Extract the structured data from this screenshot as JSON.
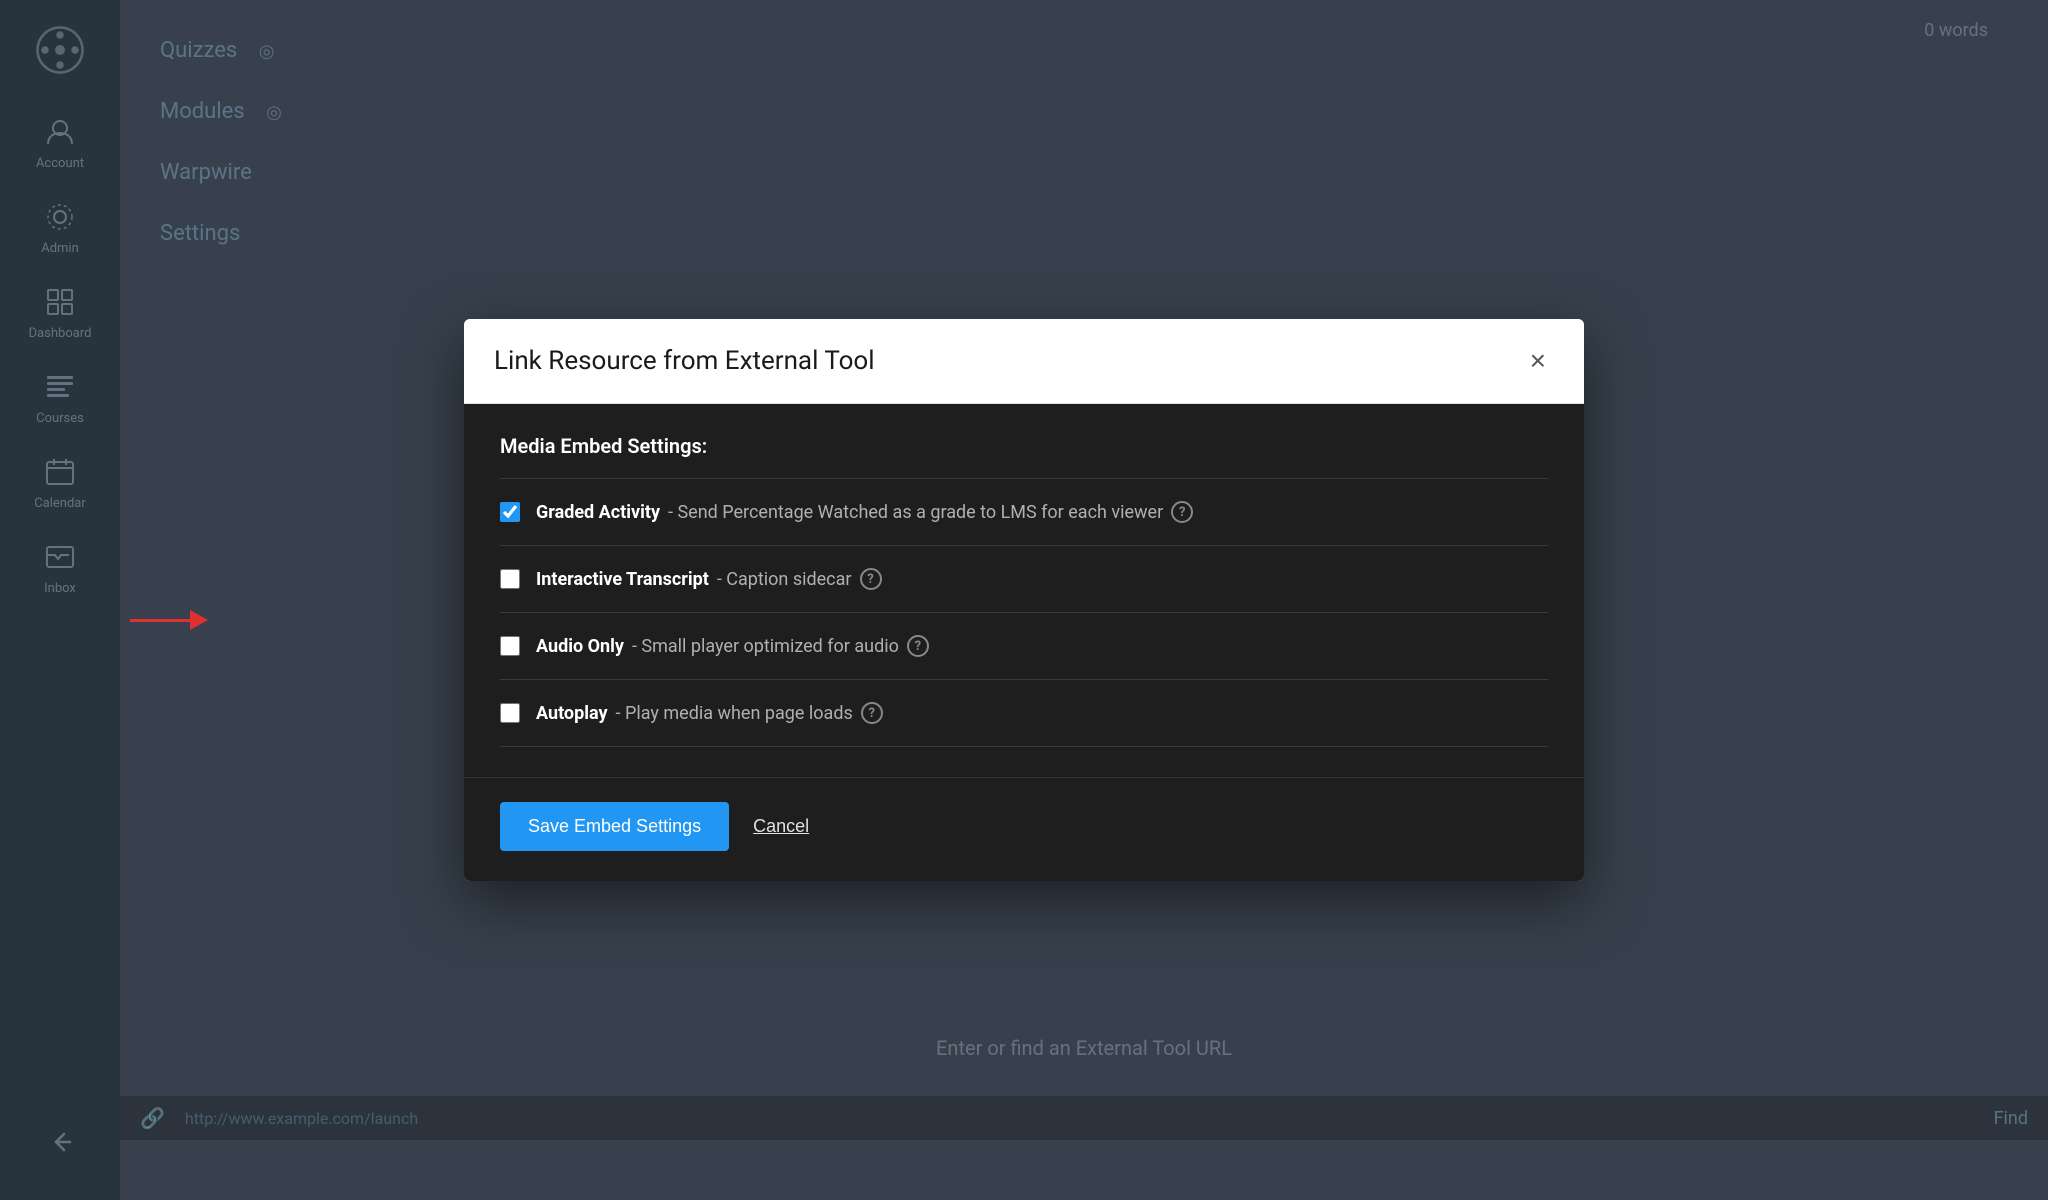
{
  "sidebar": {
    "items": [
      {
        "id": "account",
        "label": "Account",
        "icon": "account-icon"
      },
      {
        "id": "admin",
        "label": "Admin",
        "icon": "admin-icon"
      },
      {
        "id": "dashboard",
        "label": "Dashboard",
        "icon": "dashboard-icon"
      },
      {
        "id": "courses",
        "label": "Courses",
        "icon": "courses-icon"
      },
      {
        "id": "calendar",
        "label": "Calendar",
        "icon": "calendar-icon"
      },
      {
        "id": "inbox",
        "label": "Inbox",
        "icon": "inbox-icon"
      }
    ],
    "bottom_icon": "back-icon"
  },
  "background": {
    "nav_items": [
      "Quizzes",
      "Modules",
      "Warpwire",
      "Settings"
    ],
    "word_count": "0 words",
    "external_tool_label": "Enter or find an External Tool URL",
    "url_placeholder": "http://www.example.com/launch",
    "find_button": "Find"
  },
  "dialog": {
    "title": "Link Resource from External Tool",
    "close_label": "×",
    "section_title": "Media Embed Settings:",
    "settings": [
      {
        "id": "graded-activity",
        "name": "Graded Activity",
        "separator": " - ",
        "description": "Send Percentage Watched as a grade to LMS for each viewer",
        "checked": true,
        "has_help": true
      },
      {
        "id": "interactive-transcript",
        "name": "Interactive Transcript",
        "separator": " - ",
        "description": "Caption sidecar",
        "checked": false,
        "has_help": true
      },
      {
        "id": "audio-only",
        "name": "Audio Only",
        "separator": " - ",
        "description": "Small player optimized for audio",
        "checked": false,
        "has_help": true
      },
      {
        "id": "autoplay",
        "name": "Autoplay",
        "separator": " - ",
        "description": "Play media when page loads",
        "checked": false,
        "has_help": true
      }
    ],
    "save_button_label": "Save Embed Settings",
    "cancel_button_label": "Cancel"
  },
  "colors": {
    "accent": "#2196F3",
    "arrow": "#e03030",
    "sidebar_bg": "#3d4f5f",
    "dialog_body_bg": "#1e1e1e"
  }
}
